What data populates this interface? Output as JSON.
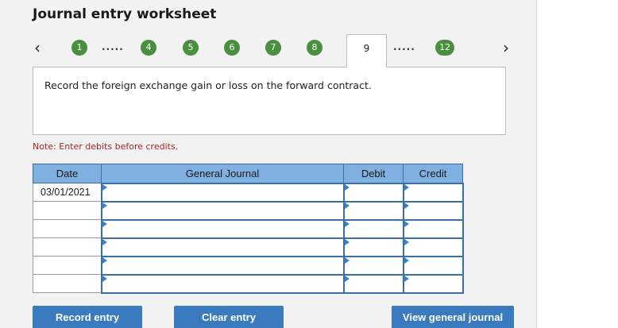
{
  "header": {
    "title": "Journal entry worksheet"
  },
  "nav": {
    "prev_icon": "chevron-left-icon",
    "next_icon": "chevron-right-icon",
    "steps_left": [
      "1",
      "4",
      "5",
      "6",
      "7",
      "8"
    ],
    "ellipsis_left": ".....",
    "active_step": "9",
    "ellipsis_right": ".....",
    "last_step": "12",
    "step_color": "#4a8f3f"
  },
  "instruction": {
    "text": "Record the foreign exchange gain or loss on the forward contract."
  },
  "note": {
    "text": "Note: Enter debits before credits.",
    "color": "#a0262b"
  },
  "journal": {
    "headers": {
      "date": "Date",
      "account": "General Journal",
      "debit": "Debit",
      "credit": "Credit"
    },
    "rows": [
      {
        "date": "03/01/2021",
        "account": "",
        "debit": "",
        "credit": ""
      },
      {
        "date": "",
        "account": "",
        "debit": "",
        "credit": ""
      },
      {
        "date": "",
        "account": "",
        "debit": "",
        "credit": ""
      },
      {
        "date": "",
        "account": "",
        "debit": "",
        "credit": ""
      },
      {
        "date": "",
        "account": "",
        "debit": "",
        "credit": ""
      },
      {
        "date": "",
        "account": "",
        "debit": "",
        "credit": ""
      }
    ],
    "header_color": "#7fb0e0"
  },
  "buttons": {
    "record": "Record entry",
    "clear": "Clear entry",
    "view": "View general journal",
    "color": "#3a7bbf"
  }
}
